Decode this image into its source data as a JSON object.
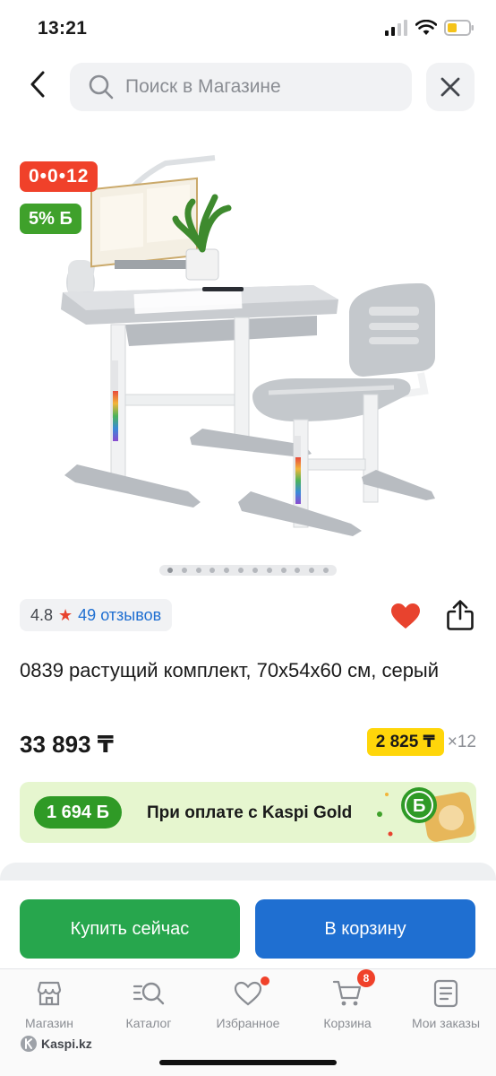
{
  "status_bar": {
    "time": "13:21"
  },
  "search": {
    "placeholder": "Поиск в Магазине"
  },
  "badges": {
    "timer": "0•0•12",
    "bonus_percent": "5% Б"
  },
  "gallery": {
    "total_images": 12,
    "active_index": 0
  },
  "rating": {
    "value": "4.8",
    "reviews": "49 отзывов"
  },
  "product": {
    "title": "0839 растущий комплект, 70х54х60 см, серый",
    "price": "33 893 ₸",
    "installment_amount": "2 825 ₸",
    "installment_multiplier": "×12",
    "favorite": true
  },
  "kaspi_gold": {
    "bonus": "1 694 Б",
    "text": "При оплате с Kaspi Gold"
  },
  "buttons": {
    "buy_now": "Купить сейчас",
    "add_to_cart": "В корзину"
  },
  "tabs": [
    {
      "label": "Магазин",
      "icon": "store-icon"
    },
    {
      "label": "Каталог",
      "icon": "catalog-search-icon"
    },
    {
      "label": "Избранное",
      "icon": "heart-outline-icon",
      "dot": true
    },
    {
      "label": "Корзина",
      "icon": "cart-icon",
      "count": "8"
    },
    {
      "label": "Мои заказы",
      "icon": "orders-icon"
    }
  ],
  "brand": "Kaspi.kz",
  "colors": {
    "accent_red": "#f0412a",
    "green": "#27a64d",
    "blue": "#1f6fd1",
    "yellow": "#ffd60a"
  }
}
